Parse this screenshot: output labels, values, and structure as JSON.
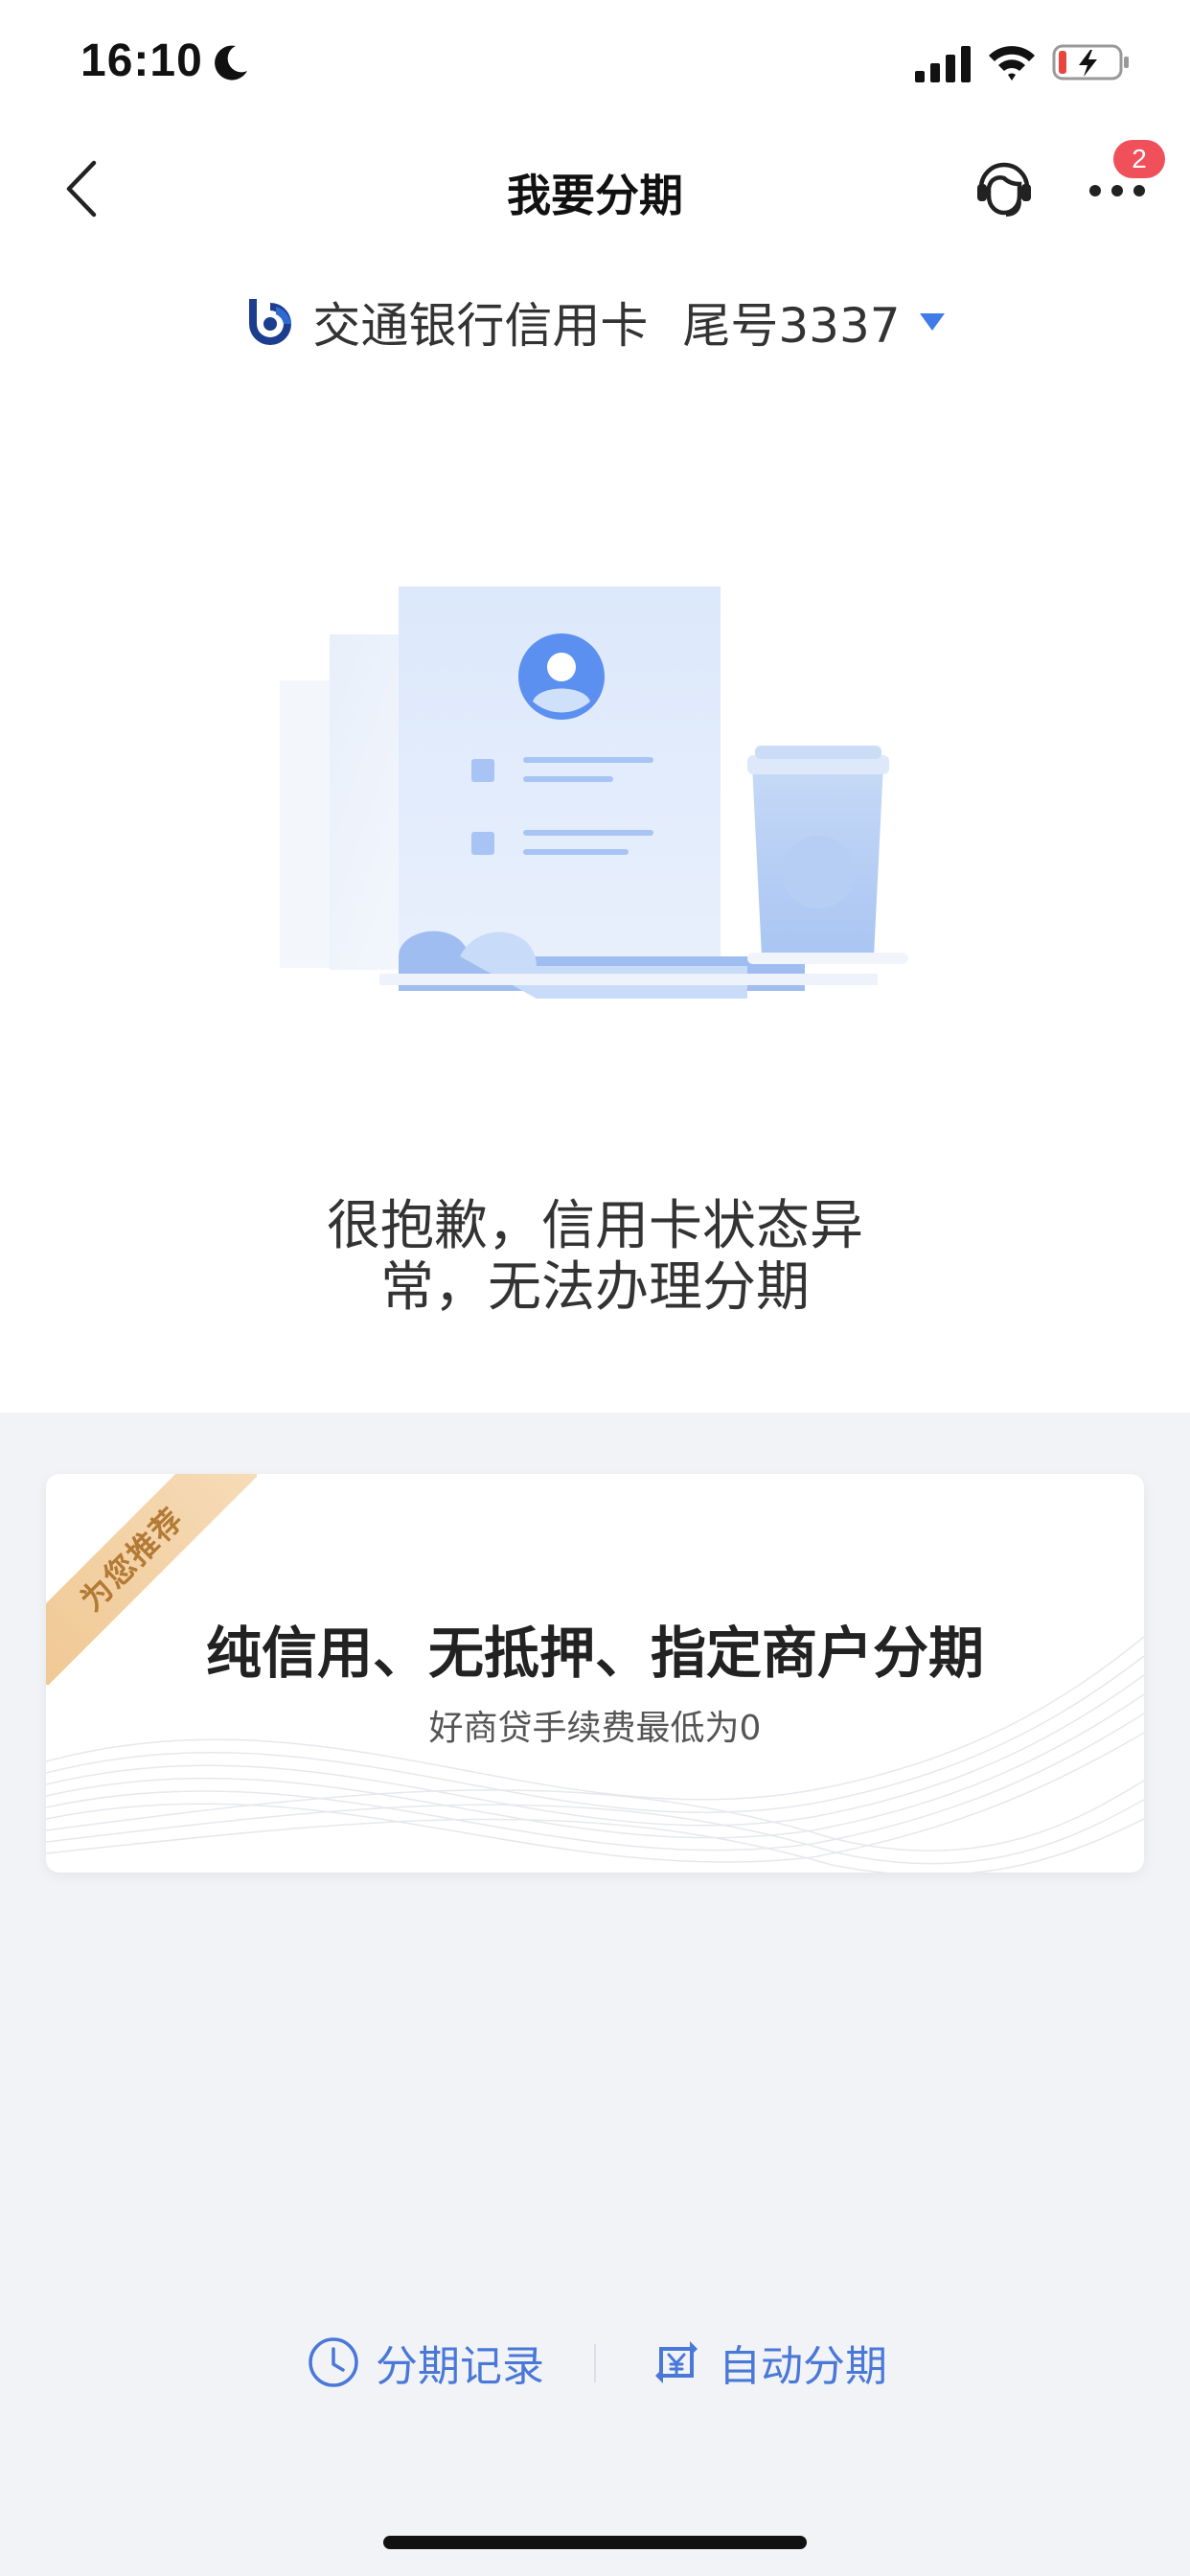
{
  "status_bar": {
    "time": "16:10"
  },
  "navbar": {
    "title": "我要分期",
    "badge_count": "2"
  },
  "card_selector": {
    "card_name": "交通银行信用卡",
    "card_tail": "尾号3337"
  },
  "message": {
    "line1": "很抱歉，信用卡状态异",
    "line2": "常，无法办理分期"
  },
  "promo": {
    "ribbon_label": "为您推荐",
    "title": "纯信用、无抵押、指定商户分期",
    "subtitle": "好商贷手续费最低为0"
  },
  "bottom_links": {
    "records_label": "分期记录",
    "auto_label": "自动分期"
  },
  "colors": {
    "accent_blue": "#4a78d8",
    "badge_red": "#f0505a",
    "ribbon_gold": "#f0c894",
    "page_bg": "#f2f3f6"
  },
  "icons": {
    "back": "chevron-left-icon",
    "service": "customer-service-icon",
    "more": "more-dots-icon",
    "card_dropdown": "triangle-down-icon",
    "records": "clock-icon",
    "auto": "yuan-cycle-icon"
  }
}
